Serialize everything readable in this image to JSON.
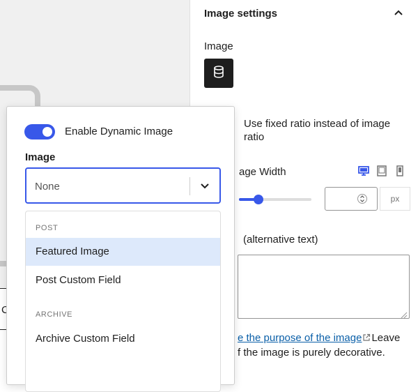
{
  "canvas": {
    "partial_text": "C"
  },
  "sidebar": {
    "panel_title": "Image settings",
    "image_label": "Image",
    "fixed_ratio_label": "Use fixed ratio instead of image ratio",
    "image_width_label": "age Width",
    "width_unit": "px",
    "width_slider_fraction": 0.27,
    "alt_label": "(alternative text)",
    "help_link": "e the purpose of the image",
    "help_after_link": "Leave",
    "help_line2": "f the image is purely decorative.",
    "accent_color": "#3858e9",
    "link_color": "#0a5fa8"
  },
  "popover": {
    "toggle_label": "Enable Dynamic Image",
    "toggle_on": true,
    "select_label": "Image",
    "select_value": "None",
    "menu": {
      "groups": [
        {
          "label": "POST",
          "items": [
            {
              "label": "Featured Image",
              "highlighted": true
            },
            {
              "label": "Post Custom Field",
              "highlighted": false
            }
          ]
        },
        {
          "label": "ARCHIVE",
          "items": [
            {
              "label": "Archive Custom Field",
              "highlighted": false
            }
          ]
        }
      ]
    }
  },
  "icons": {
    "panel_toggle": "chevron-up-icon",
    "dynamic_source": "database-icon",
    "devices": [
      "desktop-icon",
      "tablet-icon",
      "mobile-icon"
    ],
    "select_toggle": "chevron-down-icon",
    "external": "external-link-icon"
  }
}
